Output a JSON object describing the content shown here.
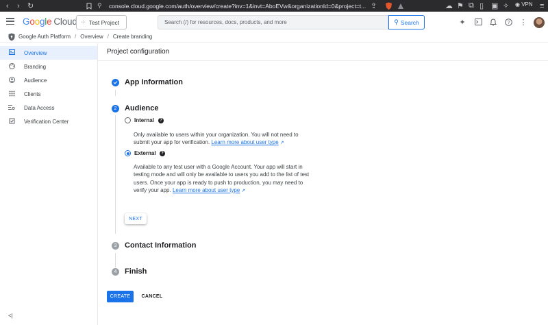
{
  "browser": {
    "url": "console.cloud.google.com/auth/overview/create?inv=1&invt=AboEVw&organizationId=0&project=t...",
    "vpn_label": "VPN"
  },
  "header": {
    "logo_google": [
      "G",
      "o",
      "o",
      "g",
      "l",
      "e"
    ],
    "logo_cloud": "Cloud",
    "project_label": "Test Project",
    "search_placeholder": "Search (/) for resources, docs, products, and more",
    "search_button": "Search"
  },
  "breadcrumb": {
    "items": [
      "Google Auth Platform",
      "Overview",
      "Create branding"
    ],
    "separator": "/"
  },
  "sidebar": {
    "items": [
      {
        "label": "Overview",
        "icon": "overview-icon",
        "active": true
      },
      {
        "label": "Branding",
        "icon": "palette-icon",
        "active": false
      },
      {
        "label": "Audience",
        "icon": "person-icon",
        "active": false
      },
      {
        "label": "Clients",
        "icon": "grid-icon",
        "active": false
      },
      {
        "label": "Data Access",
        "icon": "data-access-icon",
        "active": false
      },
      {
        "label": "Verification Center",
        "icon": "verification-icon",
        "active": false
      }
    ],
    "collapse_glyph": "<|"
  },
  "main": {
    "title": "Project configuration",
    "steps": [
      {
        "number": "1",
        "title": "App Information",
        "state": "done"
      },
      {
        "number": "2",
        "title": "Audience",
        "state": "active"
      },
      {
        "number": "3",
        "title": "Contact Information",
        "state": "todo"
      },
      {
        "number": "4",
        "title": "Finish",
        "state": "todo"
      }
    ],
    "audience": {
      "options": [
        {
          "label": "Internal",
          "selected": false,
          "description": "Only available to users within your organization. You will not need to submit your app for verification.",
          "link": "Learn more about user type"
        },
        {
          "label": "External",
          "selected": true,
          "description": "Available to any test user with a Google Account. Your app will start in testing mode and will only be available to users you add to the list of test users. Once your app is ready to push to production, you may need to verify your app.",
          "link": "Learn more about user type"
        }
      ],
      "help_glyph": "?",
      "next_label": "NEXT"
    },
    "create_label": "CREATE",
    "cancel_label": "CANCEL"
  },
  "colors": {
    "accent": "#1a73e8",
    "active_nav_bg": "#e8f0fe",
    "browser_bar": "#2b2b2e"
  }
}
